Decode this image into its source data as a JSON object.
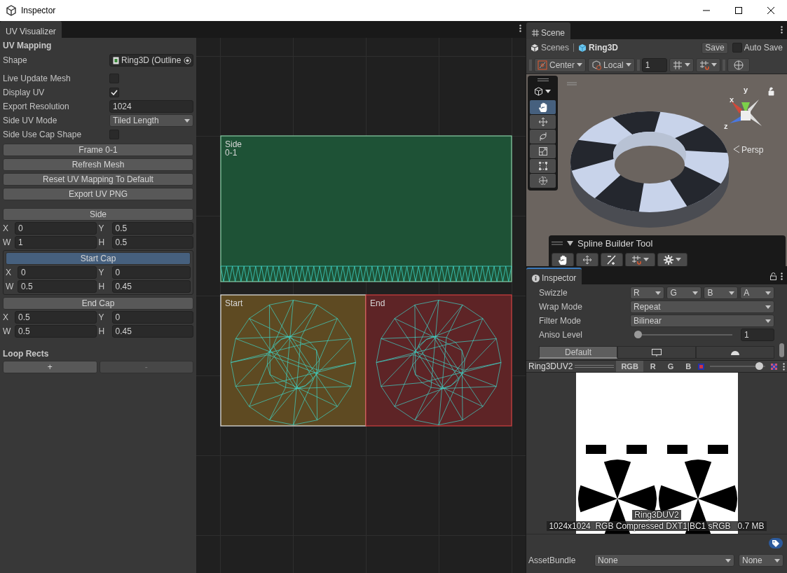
{
  "window": {
    "title": "Inspector"
  },
  "uv_visualizer": {
    "tab": "UV Visualizer",
    "heading": "UV Mapping",
    "fields": [
      {
        "kind": "object",
        "label": "Shape",
        "value": "Ring3D (Outline"
      },
      {
        "kind": "checkbox",
        "label": "Live Update Mesh",
        "checked": false
      },
      {
        "kind": "checkbox",
        "label": "Display UV",
        "checked": true
      },
      {
        "kind": "text",
        "label": "Export Resolution",
        "value": "1024"
      },
      {
        "kind": "dropdown",
        "label": "Side UV Mode",
        "value": "Tiled Length"
      },
      {
        "kind": "checkbox",
        "label": "Side Use Cap Shape",
        "checked": false
      }
    ],
    "buttons": [
      "Frame 0-1",
      "Refresh Mesh",
      "Reset UV Mapping To Default",
      "Export UV PNG"
    ],
    "rect_groups": [
      {
        "title": "Side",
        "selected": false,
        "fields": [
          {
            "label": "X",
            "value": "0"
          },
          {
            "label": "Y",
            "value": "0.5"
          },
          {
            "label": "W",
            "value": "1"
          },
          {
            "label": "H",
            "value": "0.5"
          }
        ]
      },
      {
        "title": "Start Cap",
        "selected": true,
        "fields": [
          {
            "label": "X",
            "value": "0"
          },
          {
            "label": "Y",
            "value": "0"
          },
          {
            "label": "W",
            "value": "0.5"
          },
          {
            "label": "H",
            "value": "0.45"
          }
        ]
      },
      {
        "title": "End Cap",
        "selected": false,
        "fields": [
          {
            "label": "X",
            "value": "0.5"
          },
          {
            "label": "Y",
            "value": "0"
          },
          {
            "label": "W",
            "value": "0.5"
          },
          {
            "label": "H",
            "value": "0.45"
          }
        ]
      }
    ],
    "loop_rects": {
      "heading": "Loop Rects",
      "buttons": [
        {
          "label": "+",
          "disabled": false
        },
        {
          "label": "-",
          "disabled": true
        }
      ]
    }
  },
  "uv_canvas": {
    "regions": [
      {
        "kind": "side",
        "labels": [
          "Side",
          "0-1"
        ],
        "color": "#1e5236",
        "selected": false
      },
      {
        "kind": "cap",
        "labels": [
          "Start"
        ],
        "color": "#5e4a22",
        "selected": true
      },
      {
        "kind": "cap",
        "labels": [
          "End"
        ],
        "color": "#5e2426",
        "selected": false
      }
    ]
  },
  "scene": {
    "tab": "Scene",
    "breadcrumb": [
      "Scenes",
      "Ring3D"
    ],
    "save": "Save",
    "auto_save": {
      "label": "Auto Save",
      "checked": false
    },
    "pivot": "Center",
    "space": "Local",
    "snap_value": "1",
    "tools": [
      {
        "kind": "hand",
        "selected": true
      },
      {
        "kind": "move",
        "selected": false
      },
      {
        "kind": "rotate",
        "selected": false
      },
      {
        "kind": "scale",
        "selected": false
      },
      {
        "kind": "rect",
        "selected": false
      },
      {
        "kind": "transform",
        "selected": false
      }
    ],
    "gizmo": {
      "axes": [
        "y",
        "x",
        "z"
      ],
      "projection": "Persp"
    },
    "overlay": {
      "title": "Spline Builder Tool"
    }
  },
  "inspector": {
    "tab": "Inspector",
    "swizzle": {
      "label": "Swizzle",
      "channels": [
        "R",
        "G",
        "B",
        "A"
      ]
    },
    "fields": [
      {
        "kind": "dropdown",
        "label": "Wrap Mode",
        "value": "Repeat"
      },
      {
        "kind": "dropdown",
        "label": "Filter Mode",
        "value": "Bilinear"
      },
      {
        "kind": "slider",
        "label": "Aniso Level",
        "level": 0.0,
        "value": "1"
      }
    ],
    "platform_tabs": [
      {
        "kind": "text",
        "label": "Default",
        "selected": true
      },
      {
        "kind": "monitor",
        "selected": false
      },
      {
        "kind": "android",
        "selected": false
      }
    ]
  },
  "preview": {
    "name": "Ring3DUV2",
    "channels": [
      {
        "label": "RGB",
        "selected": true
      },
      {
        "label": "R",
        "selected": false
      },
      {
        "label": "G",
        "selected": false
      },
      {
        "label": "B",
        "selected": false
      }
    ],
    "mip": {
      "level": 0.95
    },
    "caption": "Ring3DUV2",
    "info": "1024x1024  RGB Compressed DXT1|BC1 sRGB   0.7 MB"
  },
  "asset_bundle": {
    "label": "AssetBundle",
    "name": "None",
    "variant": "None"
  }
}
